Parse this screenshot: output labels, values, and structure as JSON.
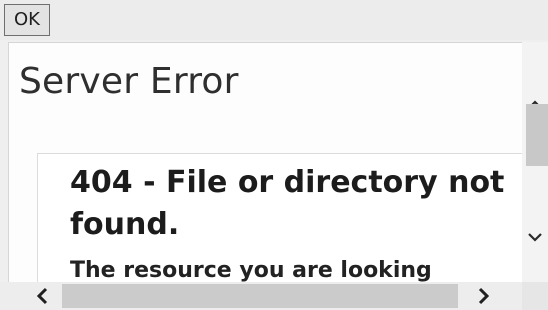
{
  "toolbar": {
    "ok_label": "OK"
  },
  "page": {
    "title": "Server Error",
    "error_heading": "404 - File or directory not found.",
    "error_body": "The resource you are looking"
  },
  "scrollbars": {
    "up_icon": "chevron-up-icon",
    "down_icon": "chevron-down-icon",
    "left_icon": "chevron-left-icon",
    "right_icon": "chevron-right-icon"
  }
}
